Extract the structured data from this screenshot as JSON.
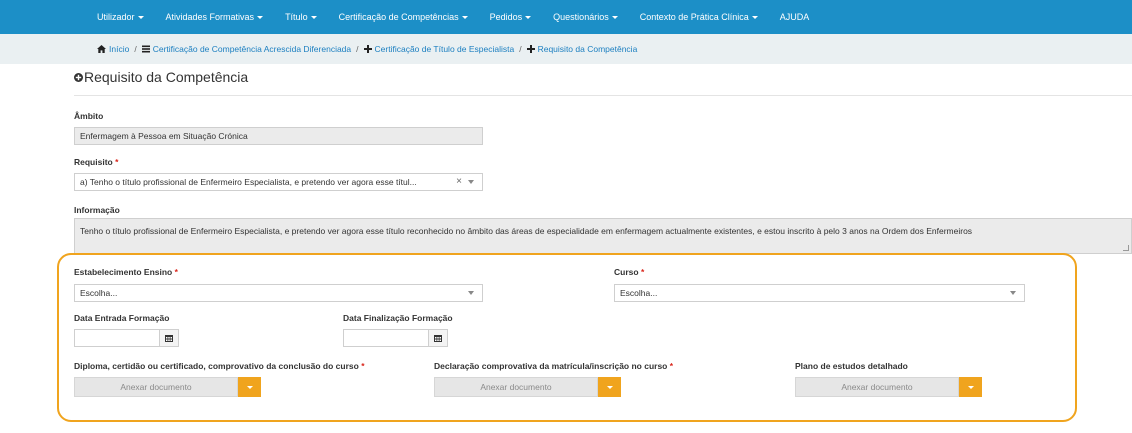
{
  "nav": {
    "items": [
      {
        "label": "Utilizador",
        "dropdown": true
      },
      {
        "label": "Atividades Formativas",
        "dropdown": true
      },
      {
        "label": "Título",
        "dropdown": true
      },
      {
        "label": "Certificação de Competências",
        "dropdown": true
      },
      {
        "label": "Pedidos",
        "dropdown": true
      },
      {
        "label": "Questionários",
        "dropdown": true
      },
      {
        "label": "Contexto de Prática Clínica",
        "dropdown": true
      },
      {
        "label": "AJUDA",
        "dropdown": false
      }
    ]
  },
  "breadcrumb": {
    "home": "Início",
    "item1": "Certificação de Competência Acrescida Diferenciada",
    "item2": "Certificação de Título de Especialista",
    "item3": "Requisito da Competência",
    "separator": "/"
  },
  "page": {
    "title": "Requisito da Competência"
  },
  "form": {
    "ambito_label": "Âmbito",
    "ambito_value": "Enfermagem à Pessoa em Situação Crónica",
    "requisito_label": "Requisito",
    "requisito_value": "a) Tenho o título profissional de Enfermeiro Especialista, e pretendo ver agora esse títul...",
    "required_mark": "*",
    "clear_symbol": "×",
    "informacao_label": "Informação",
    "informacao_value": "Tenho o título profissional de Enfermeiro Especialista, e pretendo ver agora esse título reconhecido no âmbito das áreas de especialidade em enfermagem actualmente existentes, e estou inscrito à pelo 3 anos na Ordem dos Enfermeiros",
    "estabelecimento_label": "Estabelecimento Ensino",
    "estabelecimento_value": "Escolha...",
    "curso_label": "Curso",
    "curso_value": "Escolha...",
    "data_entrada_label": "Data Entrada Formação",
    "data_finalizacao_label": "Data Finalização Formação",
    "diploma_label": "Diploma, certidão ou certificado, comprovativo da conclusão do curso",
    "declaracao_label": "Declaração comprovativa da matrícula/inscrição no curso",
    "plano_label": "Plano de estudos detalhado",
    "attach_placeholder": "Anexar documento"
  },
  "colors": {
    "nav_bg": "#1c8fc7",
    "breadcrumb_bg": "#eaf0f2",
    "link": "#1c7fc0",
    "accent_orange": "#f0a41e",
    "required_red": "#d9261c"
  }
}
